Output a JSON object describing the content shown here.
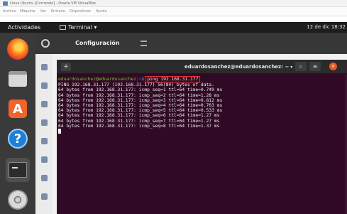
{
  "vbox": {
    "title": "Linux Ubuntu [Corriendo] - Oracle VM VirtualBox",
    "menu": [
      "Archivo",
      "Máquina",
      "Ver",
      "Entrada",
      "Dispositivos",
      "Ayuda"
    ]
  },
  "topbar": {
    "activities": "Actividades",
    "app_menu": "Terminal ▾",
    "clock": "12 de dic 18:32"
  },
  "dock": {
    "items": [
      {
        "name": "Firefox",
        "icon": "firefox-icon"
      },
      {
        "name": "Archivos",
        "icon": "files-icon"
      },
      {
        "name": "Ubuntu Software",
        "icon": "software-store-icon",
        "glyph": "A"
      },
      {
        "name": "Ayuda",
        "icon": "help-icon",
        "glyph": "?"
      },
      {
        "name": "Terminal",
        "icon": "terminal-icon"
      },
      {
        "name": "Disco",
        "icon": "disc-icon"
      }
    ]
  },
  "settings": {
    "title": "Configuración"
  },
  "terminal": {
    "title": "eduardosanchez@eduardosanchez: ~",
    "prompt_user": "eduardosanchez@eduardosanchez",
    "prompt_path": ":~$",
    "command": "ping 192.168.31.177",
    "output": [
      "PING 192.168.31.177 (192.168.31.177) 56(84) bytes of data.",
      "64 bytes from 192.168.31.177: icmp_seq=1 ttl=64 time=0.749 ms",
      "64 bytes from 192.168.31.177: icmp_seq=2 ttl=64 time=1.28 ms",
      "64 bytes from 192.168.31.177: icmp_seq=3 ttl=64 time=0.812 ms",
      "64 bytes from 192.168.31.177: icmp_seq=4 ttl=64 time=0.703 ms",
      "64 bytes from 192.168.31.177: icmp_seq=5 ttl=64 time=0.533 ms",
      "64 bytes from 192.168.31.177: icmp_seq=6 ttl=64 time=1.27 ms",
      "64 bytes from 192.168.31.177: icmp_seq=7 ttl=64 time=1.27 ms",
      "64 bytes from 192.168.31.177: icmp_seq=8 ttl=64 time=1.37 ms"
    ]
  },
  "colors": {
    "terminal_bg": "#300a24",
    "prompt_user": "#74c02c",
    "prompt_path": "#6b8fd6",
    "highlight_box": "#e52d2d",
    "dock_bg": "#3a3a3a",
    "topbar_bg": "#1d1d1d"
  }
}
